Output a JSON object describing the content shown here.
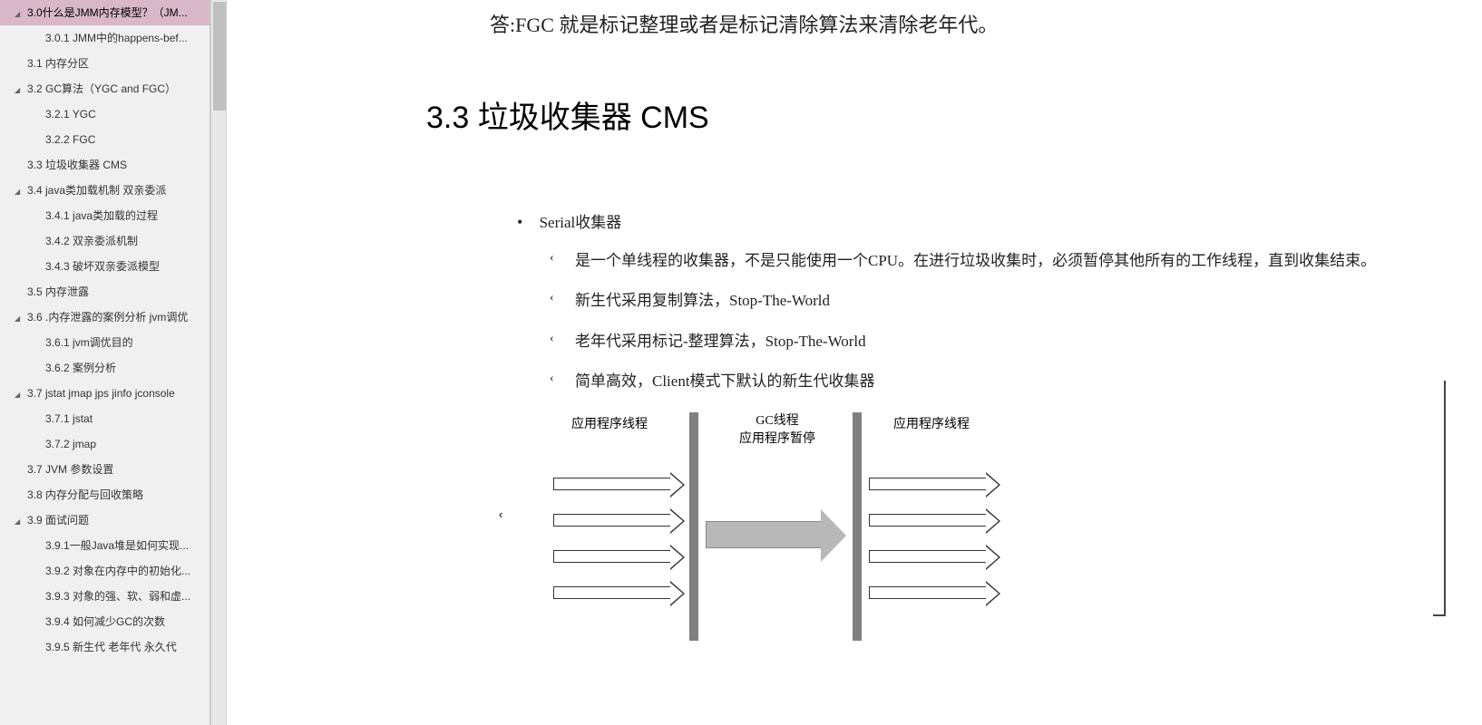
{
  "sidebar": {
    "items": [
      {
        "label": "3.0什么是JMM内存模型？（JM...",
        "level": 0,
        "hasChildren": true,
        "selected": true
      },
      {
        "label": "3.0.1 JMM中的happens-bef...",
        "level": 1
      },
      {
        "label": "3.1 内存分区",
        "level": 0
      },
      {
        "label": "3.2 GC算法（YGC and FGC）",
        "level": 0,
        "hasChildren": true
      },
      {
        "label": "3.2.1 YGC",
        "level": 1
      },
      {
        "label": "3.2.2 FGC",
        "level": 1
      },
      {
        "label": "3.3 垃圾收集器 CMS",
        "level": 0
      },
      {
        "label": "3.4 java类加载机制 双亲委派",
        "level": 0,
        "hasChildren": true
      },
      {
        "label": "3.4.1 java类加载的过程",
        "level": 1
      },
      {
        "label": "3.4.2 双亲委派机制",
        "level": 1
      },
      {
        "label": "3.4.3 破坏双亲委派模型",
        "level": 1
      },
      {
        "label": "3.5 内存泄露",
        "level": 0
      },
      {
        "label": "3.6 .内存泄露的案例分析 jvm调优",
        "level": 0,
        "hasChildren": true
      },
      {
        "label": "3.6.1 jvm调优目的",
        "level": 1
      },
      {
        "label": "3.6.2 案例分析",
        "level": 1
      },
      {
        "label": "3.7 jstat jmap jps jinfo jconsole",
        "level": 0,
        "hasChildren": true
      },
      {
        "label": "3.7.1 jstat",
        "level": 1
      },
      {
        "label": "3.7.2 jmap",
        "level": 1
      },
      {
        "label": "3.7 JVM 参数设置",
        "level": 0
      },
      {
        "label": "3.8 内存分配与回收策略",
        "level": 0
      },
      {
        "label": "3.9 面试问题",
        "level": 0,
        "hasChildren": true
      },
      {
        "label": "3.9.1一般Java堆是如何实现...",
        "level": 1
      },
      {
        "label": "3.9.2 对象在内存中的初始化...",
        "level": 1
      },
      {
        "label": "3.9.3 对象的强、软、弱和虚...",
        "level": 1
      },
      {
        "label": "3.9.4 如何减少GC的次数",
        "level": 1
      },
      {
        "label": "3.9.5  新生代 老年代 永久代",
        "level": 1
      }
    ]
  },
  "content": {
    "answer": "答:FGC  就是标记整理或者是标记清除算法来清除老年代。",
    "heading": "3.3  垃圾收集器  CMS",
    "bulletTitle": "Serial收集器",
    "bullets": [
      "是一个单线程的收集器，不是只能使用一个CPU。在进行垃圾收集时，必须暂停其他所有的工作线程，直到收集结束。",
      "新生代采用复制算法，Stop-The-World",
      "老年代采用标记-整理算法，Stop-The-World",
      "简单高效，Client模式下默认的新生代收集器"
    ],
    "diagram": {
      "leftLabel": "应用程序线程",
      "midLabel1": "GC线程",
      "midLabel2": "应用程序暂停",
      "rightLabel": "应用程序线程"
    }
  }
}
